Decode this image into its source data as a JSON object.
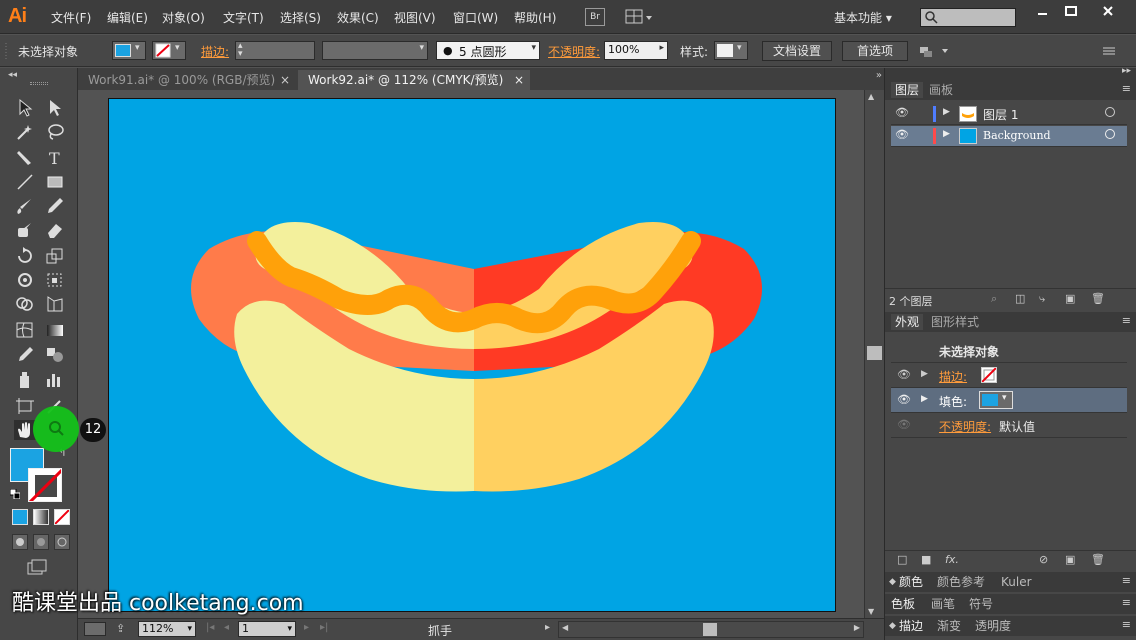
{
  "app": {
    "logo": "Ai"
  },
  "menu": [
    "文件(F)",
    "编辑(E)",
    "对象(O)",
    "文字(T)",
    "选择(S)",
    "效果(C)",
    "视图(V)",
    "窗口(W)",
    "帮助(H)"
  ],
  "bridge_label": "Br",
  "workspace": "基本功能",
  "control": {
    "selection_label": "未选择对象",
    "stroke_label": "描边:",
    "brush_label": "5 点圆形",
    "opacity_label": "不透明度:",
    "opacity_value": "100%",
    "style_label": "样式:",
    "doc_setup_button": "文档设置",
    "prefs_button": "首选项"
  },
  "tabs": [
    {
      "label": "Work91.ai* @ 100% (RGB/预览)",
      "active": false
    },
    {
      "label": "Work92.ai* @ 112% (CMYK/预览)",
      "active": true
    }
  ],
  "status": {
    "zoom": "112%",
    "page": "1",
    "tool_name": "抓手"
  },
  "layers_panel": {
    "tabs": [
      "图层",
      "画板"
    ],
    "layers": [
      {
        "name": "图层 1",
        "color": "#4f7dff"
      },
      {
        "name": "Background",
        "color": "#ff4a4a"
      }
    ],
    "count": "2 个图层"
  },
  "appearance_panel": {
    "tabs": [
      "外观",
      "图形样式"
    ],
    "header": "未选择对象",
    "stroke_label": "描边:",
    "fill_label": "填色:",
    "opacity_label": "不透明度:",
    "opacity_value": "默认值"
  },
  "collapsed_panels": [
    [
      "颜色",
      "颜色参考",
      "Kuler"
    ],
    [
      "色板",
      "画笔",
      "符号"
    ],
    [
      "描边",
      "渐变",
      "透明度"
    ]
  ],
  "overlay": {
    "cursor_badge": "12",
    "watermark": "酷课堂出品 coolketang.com"
  },
  "colors": {
    "fill": "#1ba3e2",
    "artboard_bg": "#00a4e4",
    "bun_light": "#f3f09c",
    "bun_dark": "#ffd060",
    "sausage_left": "#ff7b4a",
    "sausage_right": "#ff3a24",
    "mustard": "#ffa10a"
  }
}
